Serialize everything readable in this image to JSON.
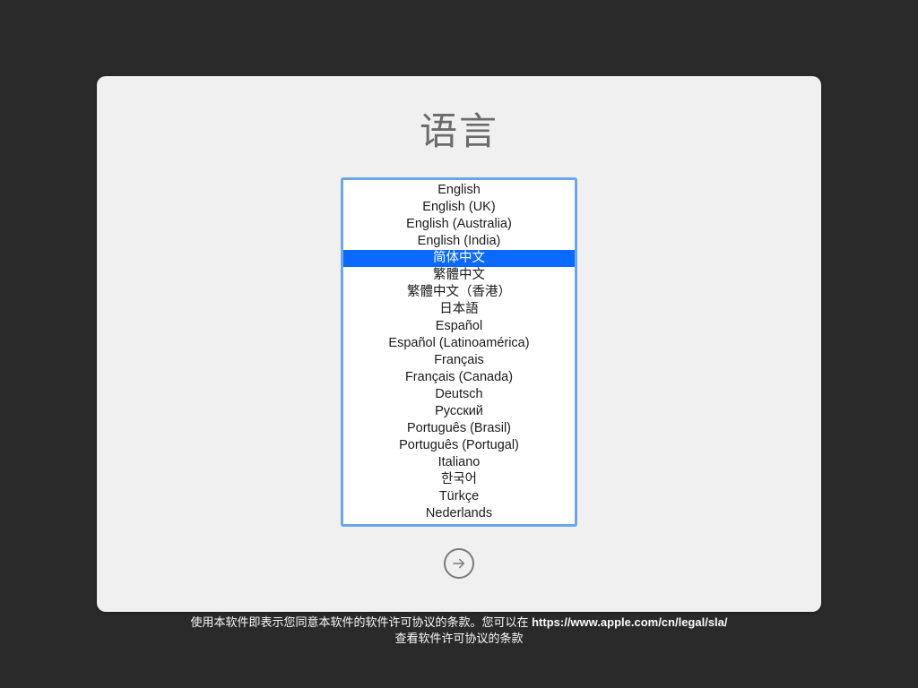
{
  "title": "语言",
  "selected_index": 4,
  "languages": [
    "English",
    "English (UK)",
    "English (Australia)",
    "English (India)",
    "简体中文",
    "繁體中文",
    "繁體中文（香港）",
    "日本語",
    "Español",
    "Español (Latinoamérica)",
    "Français",
    "Français (Canada)",
    "Deutsch",
    "Русский",
    "Português (Brasil)",
    "Português (Portugal)",
    "Italiano",
    "한국어",
    "Türkçe",
    "Nederlands"
  ],
  "footer": {
    "line1_prefix": "使用本软件即表示您同意本软件的软件许可协议的条款。您可以在 ",
    "url": "https://www.apple.com/cn/legal/sla/",
    "line2": "查看软件许可协议的条款"
  }
}
